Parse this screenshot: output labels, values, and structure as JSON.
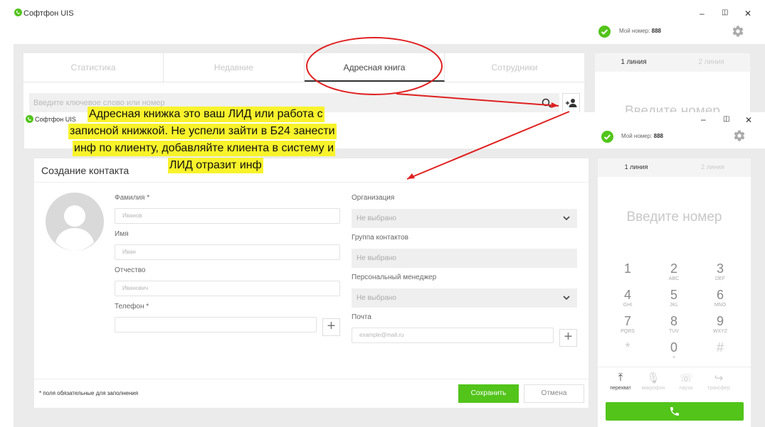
{
  "back_window": {
    "title": "Софтфон UIS",
    "my_number_label": "Мой номер:",
    "my_number": "888",
    "tabs": [
      "Статистика",
      "Недавние",
      "Адресная книга",
      "Сотрудники"
    ],
    "search_placeholder": "Введите ключевое слово или номер",
    "line_tabs": [
      "1 линия",
      "2 линия"
    ],
    "dial_placeholder": "Введите номер"
  },
  "front_window": {
    "title": "Софтфон UIS",
    "my_number_label": "Мой номер:",
    "my_number": "888",
    "form_title": "Создание контакта",
    "fields": {
      "surname_label": "Фамилия *",
      "surname_placeholder": "Иванов",
      "name_label": "Имя",
      "name_placeholder": "Иван",
      "patronymic_label": "Отчество",
      "patronymic_placeholder": "Иванович",
      "phone_label": "Телефон *",
      "org_label": "Организация",
      "org_value": "Не выбрано",
      "group_label": "Группа контактов",
      "group_value": "Не выбрано",
      "manager_label": "Персональный менеджер",
      "manager_value": "Не выбрано",
      "email_label": "Почта",
      "email_placeholder": "example@mail.ru"
    },
    "required_note": "* поля обязательные для заполнения",
    "save_label": "Сохранить",
    "cancel_label": "Отмена",
    "line_tabs": [
      "1 линия",
      "2 линия"
    ],
    "dial_placeholder": "Введите номер",
    "keypad": [
      {
        "d": "1",
        "l": ""
      },
      {
        "d": "2",
        "l": "ABC"
      },
      {
        "d": "3",
        "l": "DEF"
      },
      {
        "d": "4",
        "l": "GHI"
      },
      {
        "d": "5",
        "l": "JKL"
      },
      {
        "d": "6",
        "l": "MNO"
      },
      {
        "d": "7",
        "l": "PQRS"
      },
      {
        "d": "8",
        "l": "TUV"
      },
      {
        "d": "9",
        "l": "WXYZ"
      },
      {
        "d": "*",
        "l": ""
      },
      {
        "d": "0",
        "l": "+"
      },
      {
        "d": "#",
        "l": ""
      }
    ],
    "actions": [
      "перехват",
      "микрофон",
      "пауза",
      "трансфер"
    ]
  },
  "annotation": {
    "lines": [
      "Адресная книжка это ваш ЛИД или работа с",
      "записной книжкой. Не успели зайти в Б24 занести",
      "инф по клиенту, добавляйте клиента в систему и",
      "ЛИД отразит инф"
    ]
  },
  "colors": {
    "brand_green": "#52c41a",
    "tab_active_underline": "#333333",
    "callout_yellow": "#f8f32b",
    "arrow_red": "#e02020"
  }
}
